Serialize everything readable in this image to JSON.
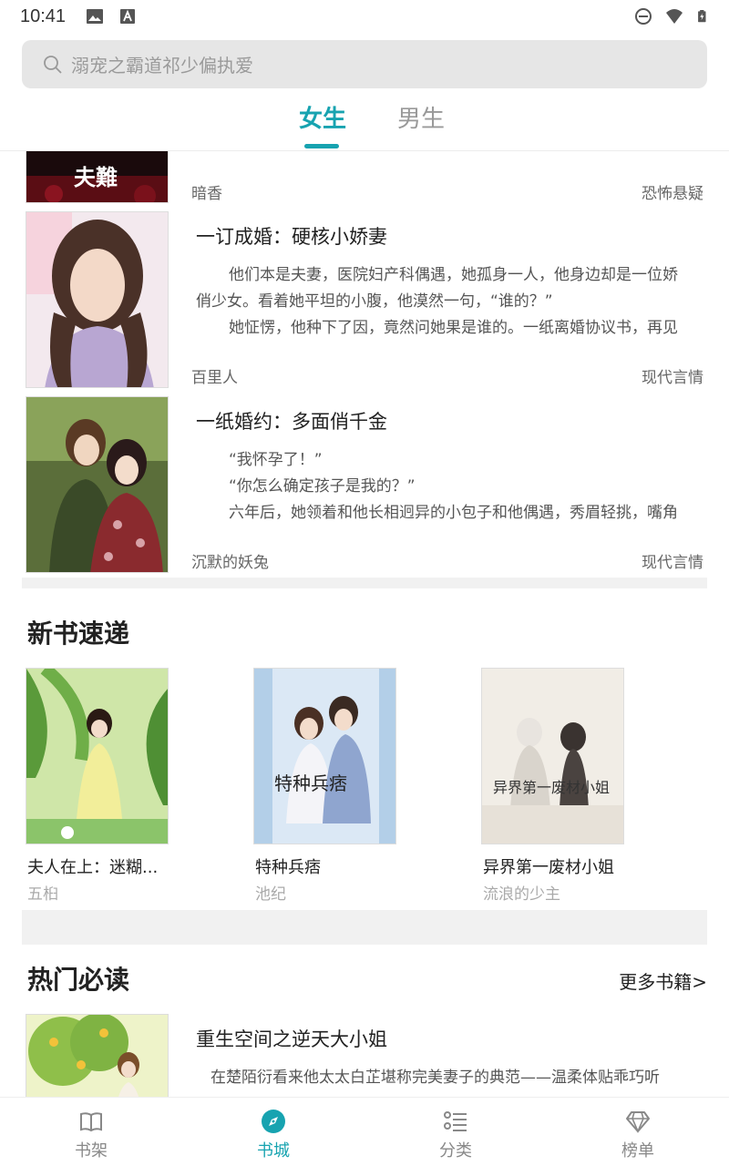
{
  "status_bar": {
    "time": "10:41"
  },
  "search": {
    "placeholder": "溺宠之霸道祁少偏执爱"
  },
  "gender_tabs": [
    {
      "label": "女生",
      "active": true
    },
    {
      "label": "男生",
      "active": false
    }
  ],
  "book_list": [
    {
      "title": "",
      "author": "暗香",
      "category": "恐怖悬疑",
      "cover_text": "夫難"
    },
    {
      "title": "一订成婚：硬核小娇妻",
      "intro": [
        "他们本是夫妻，医院妇产科偶遇，她孤身一人，他身边却是一位娇",
        "俏少女。看着她平坦的小腹，他漠然一句，“谁的？”",
        "她怔愣，他种下了因，竟然问她果是谁的。一纸离婚协议书，再见"
      ],
      "author": "百里人",
      "category": "现代言情"
    },
    {
      "title": "一纸婚约：多面俏千金",
      "intro": [
        "“我怀孕了！”",
        "“你怎么确定孩子是我的？”",
        "六年后，她领着和他长相迥异的小包子和他偶遇，秀眉轻挑，嘴角"
      ],
      "author": "沉默的妖兔",
      "category": "现代言情"
    }
  ],
  "new_books": {
    "title": "新书速递",
    "items": [
      {
        "title": "夫人在上：迷糊...",
        "author": "五桕"
      },
      {
        "title": "特种兵痞",
        "author": "池纪",
        "cover_text": "特种兵痞"
      },
      {
        "title": "异界第一废材小姐",
        "author": "流浪的少主",
        "cover_text": "异界第一废材小姐"
      }
    ]
  },
  "hot_reads": {
    "title": "热门必读",
    "more": "更多书籍>",
    "items": [
      {
        "title": "重生空间之逆天大小姐",
        "intro": [
          "在楚陌衍看来他太太白芷堪称完美妻子的典范——温柔体贴乖巧听"
        ]
      }
    ]
  },
  "bottom_nav": [
    {
      "label": "书架",
      "icon": "book-icon",
      "active": false
    },
    {
      "label": "书城",
      "icon": "compass-icon",
      "active": true
    },
    {
      "label": "分类",
      "icon": "list-icon",
      "active": false
    },
    {
      "label": "榜单",
      "icon": "diamond-icon",
      "active": false
    }
  ],
  "colors": {
    "accent": "#17a3b0",
    "background": "#ffffff",
    "divider": "#f1f1f1"
  }
}
